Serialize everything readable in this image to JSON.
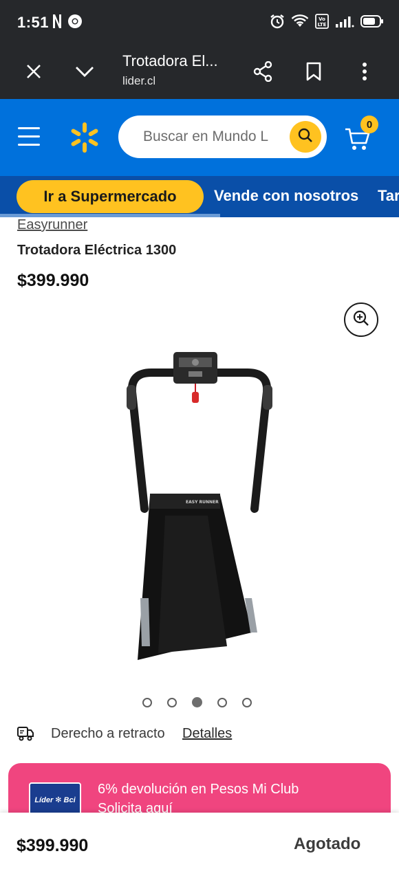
{
  "status_bar": {
    "time": "1:51",
    "left_icons": [
      "netflix-icon",
      "chrome-icon"
    ],
    "right_icons": [
      "alarm-icon",
      "wifi-icon",
      "volte-icon",
      "signal-icon",
      "battery-icon"
    ],
    "volte_label": "VoLTE"
  },
  "browser": {
    "page_title": "Trotadora El...",
    "url": "lider.cl",
    "buttons": [
      "close-icon",
      "chevron-down-icon",
      "share-icon",
      "bookmark-icon",
      "more-vert-icon"
    ]
  },
  "header": {
    "search": {
      "placeholder": "Buscar en Mundo L"
    },
    "cart_count": "0",
    "colors": {
      "brand_blue": "#0071dc",
      "spark_yellow": "#ffc220",
      "nav_blue": "#0a4fa8"
    }
  },
  "nav": {
    "pill_label": "Ir a Supermercado",
    "links": [
      "Vende con nosotros",
      "Tar"
    ]
  },
  "product": {
    "brand": "Easyrunner",
    "title": "Trotadora Eléctrica 1300",
    "price": "$399.990",
    "image_label": "EASY RUNNER",
    "carousel": {
      "total": 5,
      "active_index": 2
    }
  },
  "retracto": {
    "text": "Derecho a retracto",
    "link": "Detalles"
  },
  "promo": {
    "card_label": "Líder ✻ Bci",
    "title": "6% devolución en Pesos Mi Club",
    "subtitle": "Solicita aquí",
    "color": "#f0457f"
  },
  "bottom_bar": {
    "price": "$399.990",
    "status": "Agotado"
  }
}
